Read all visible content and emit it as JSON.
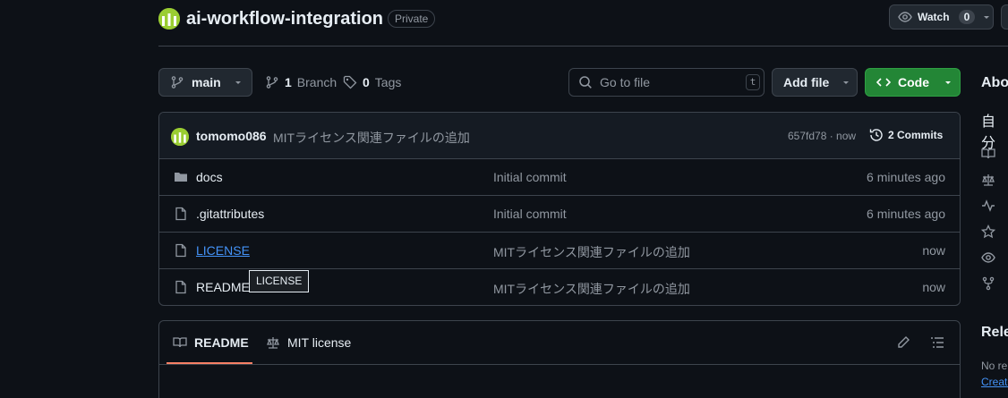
{
  "repo": {
    "name": "ai-workflow-integration",
    "visibility": "Private",
    "watch_label": "Watch",
    "watch_count": "0"
  },
  "toolbar": {
    "branch": "main",
    "branch_count": "1",
    "branch_label": "Branch",
    "tag_count": "0",
    "tag_label": "Tags",
    "goto_placeholder": "Go to file",
    "goto_shortcut": "t",
    "add_file_label": "Add file",
    "code_label": "Code"
  },
  "latest_commit": {
    "author": "tomomo086",
    "message": "MITライセンス関連ファイルの追加",
    "sha_time": "657fd78 · now",
    "commits_label": "2 Commits"
  },
  "files": [
    {
      "type": "folder",
      "name": "docs",
      "commit": "Initial commit",
      "time": "6 minutes ago"
    },
    {
      "type": "file",
      "name": ".gitattributes",
      "commit": "Initial commit",
      "time": "6 minutes ago"
    },
    {
      "type": "file",
      "name": "LICENSE",
      "commit": "MITライセンス関連ファイルの追加",
      "time": "now"
    },
    {
      "type": "file",
      "name": "README.md",
      "commit": "MITライセンス関連ファイルの追加",
      "time": "now"
    }
  ],
  "tooltip": "LICENSE",
  "readme": {
    "tab_readme": "README",
    "tab_license": "MIT license"
  },
  "sidebar": {
    "about_label": "Abo",
    "description": "自分",
    "releases_label": "Rele",
    "no_releases": "No re",
    "create_link": "Create"
  },
  "colors": {
    "background": "#0d1117",
    "accent_green": "#238636",
    "link_blue": "#4493f8",
    "tab_underline": "#f78166"
  }
}
